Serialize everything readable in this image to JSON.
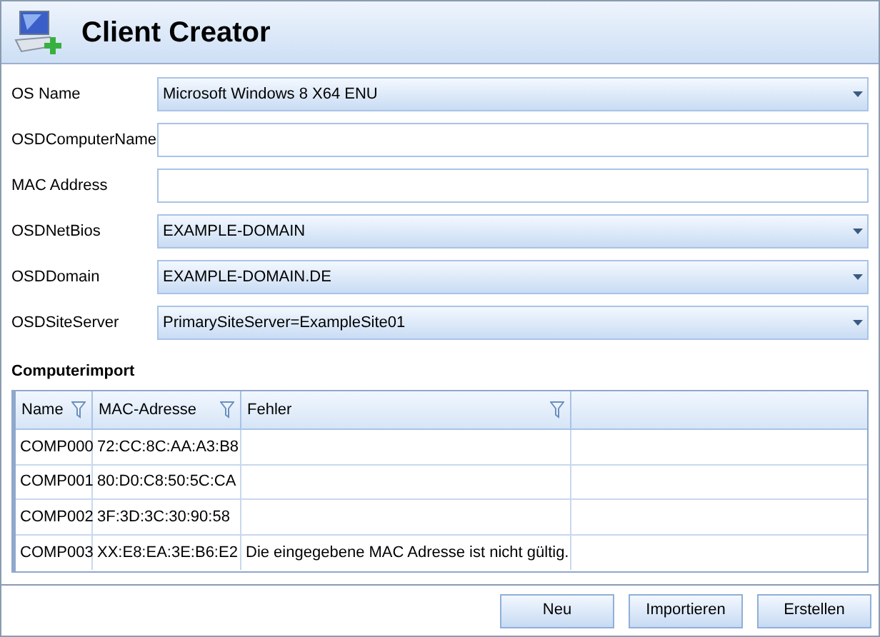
{
  "window": {
    "title": "Client Creator"
  },
  "fields": [
    {
      "label": "OS Name",
      "kind": "dropdown",
      "value": "Microsoft Windows 8 X64 ENU"
    },
    {
      "label": "OSDComputerName",
      "kind": "text"
    },
    {
      "label": "MAC Address",
      "kind": "text"
    },
    {
      "label": "OSDNetBios",
      "kind": "dropdown",
      "value": "EXAMPLE-DOMAIN"
    },
    {
      "label": "OSDDomain",
      "kind": "dropdown",
      "value": "EXAMPLE-DOMAIN.DE"
    },
    {
      "label": "OSDSiteServer",
      "kind": "dropdown",
      "value": "PrimarySiteServer=ExampleSite01"
    }
  ],
  "section": {
    "title": "Computerimport"
  },
  "table": {
    "columns": [
      "Name",
      "MAC-Adresse",
      "Fehler"
    ],
    "rows": [
      [
        "COMP000",
        "72:CC:8C:AA:A3:B8",
        ""
      ],
      [
        "COMP001",
        "80:D0:C8:50:5C:CA",
        ""
      ],
      [
        "COMP002",
        "3F:3D:3C:30:90:58",
        ""
      ],
      [
        "COMP003",
        "XX:E8:EA:3E:B6:E2",
        "Die eingegebene MAC Adresse ist nicht gültig."
      ]
    ]
  },
  "buttons": [
    "Neu",
    "Importieren",
    "Erstellen"
  ]
}
